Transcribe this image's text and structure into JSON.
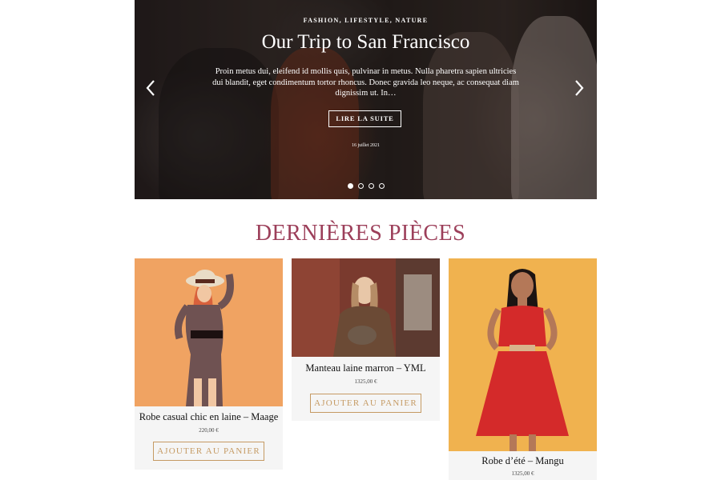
{
  "hero": {
    "categories": "FASHION, LIFESTYLE, NATURE",
    "title": "Our Trip to San Francisco",
    "excerpt": "Proin metus dui, eleifend id mollis quis, pulvinar in metus. Nulla pharetra sapien ultricies dui blandit, eget condimentum tortor rhoncus. Donec gravida leo neque, ac consequat diam dignissim ut. In…",
    "button_label": "LIRE LA SUITE",
    "date": "16 juillet 2021",
    "slide_count": 4,
    "active_slide": 1
  },
  "section": {
    "title": "DERNIÈRES PIÈCES"
  },
  "products": [
    {
      "name": "Robe casual chic en laine – Maage",
      "price": "220,00 €",
      "button": "AJOUTER AU PANIER",
      "image_bg": "#f0a362"
    },
    {
      "name": "Manteau laine marron – YML",
      "price": "1325,00 €",
      "button": "AJOUTER AU PANIER",
      "image_bg": "#7a3a2e"
    },
    {
      "name": "Robe d’été – Mangu",
      "price": "1325,00 €",
      "image_bg": "#f0b24f"
    }
  ],
  "colors": {
    "accent": "#9c3f5a",
    "button": "#c59a63",
    "card_bg": "#f5f5f5"
  }
}
